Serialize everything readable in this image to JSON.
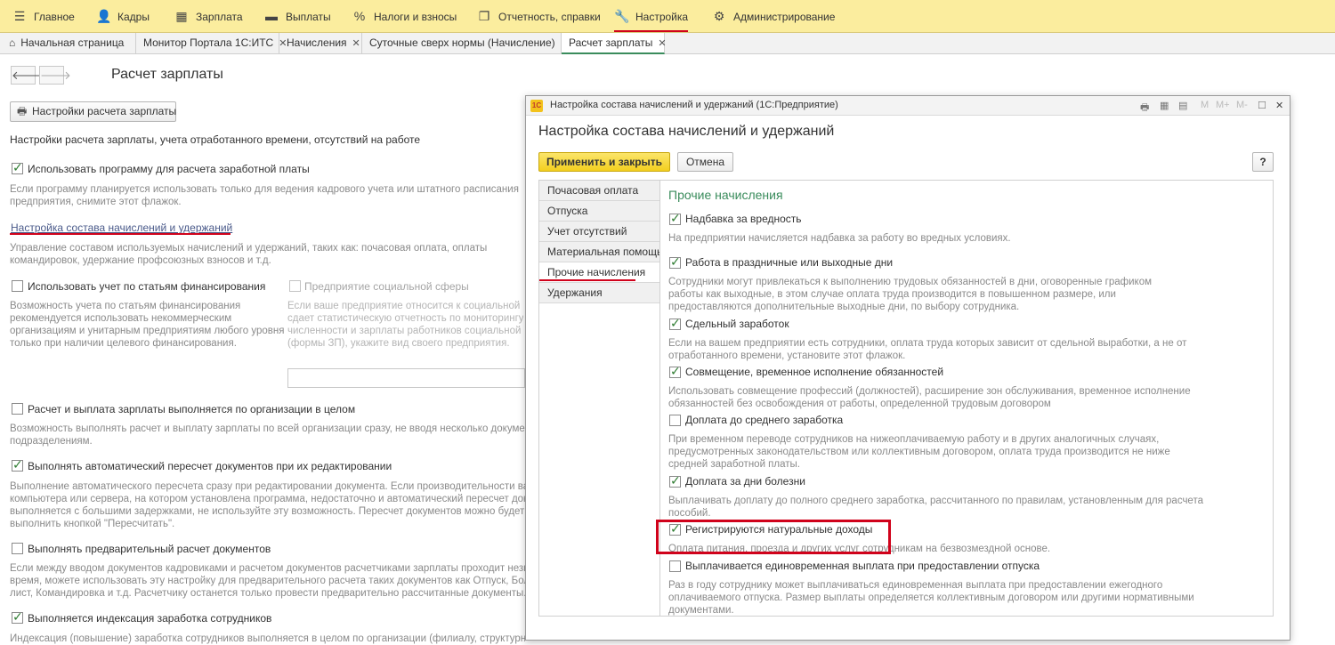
{
  "sections": [
    {
      "label": "Главное",
      "icon": "menu-icon"
    },
    {
      "label": "Кадры",
      "icon": "people-icon"
    },
    {
      "label": "Зарплата",
      "icon": "calculator-icon"
    },
    {
      "label": "Выплаты",
      "icon": "wallet-icon"
    },
    {
      "label": "Налоги и взносы",
      "icon": "percent-icon"
    },
    {
      "label": "Отчетность, справки",
      "icon": "report-icon"
    },
    {
      "label": "Настройка",
      "icon": "wrench-icon"
    },
    {
      "label": "Администрирование",
      "icon": "gear-icon"
    }
  ],
  "tabs": [
    {
      "label": "Начальная страница"
    },
    {
      "label": "Монитор Портала 1С:ИТС"
    },
    {
      "label": "Начисления"
    },
    {
      "label": "Суточные сверх нормы (Начисление)"
    },
    {
      "label": "Расчет зарплаты"
    }
  ],
  "page": {
    "title": "Расчет зарплаты",
    "settings_button": "Настройки расчета зарплаты",
    "intro": "Настройки расчета зарплаты, учета отработанного времени, отсутствий на работе",
    "opt_use_program": "Использовать программу для расчета заработной платы",
    "note_use_program": [
      "Если программу планируется использовать только для ведения кадрового учета или штатного расписания",
      "предприятия, снимите этот флажок."
    ],
    "link_setup": "Настройка состава начислений и удержаний",
    "note_setup": [
      "Управление составом используемых начислений и удержаний, таких как: почасовая оплата, оплаты",
      "командировок, удержание профсоюзных взносов и т.д."
    ],
    "opt_financing": "Использовать учет по статьям финансирования",
    "note_financing": [
      "Возможность учета по статьям финансирования",
      "рекомендуется использовать некоммерческим",
      "организациям и унитарным предприятиям любого уровня",
      "только при наличии целевого финансирования."
    ],
    "opt_social": "Предприятие социальной сферы",
    "note_social": [
      "Если ваше предприятие относится к социальной сф",
      "сдает статистическую отчетность по мониторингу",
      "численности и зарплаты работников социальной сф",
      "(формы ЗП), укажите вид своего предприятия."
    ],
    "opt_org": "Расчет и выплата зарплаты выполняется по организации в целом",
    "note_org": [
      "Возможность выполнять расчет и выплату зарплаты по всей организации сразу, не вводя несколько документ",
      "подразделениям."
    ],
    "opt_recalc": "Выполнять автоматический пересчет документов при их редактировании",
    "note_recalc": [
      "Выполнение автоматического пересчета сразу при редактировании документа. Если производительности ваш",
      "компьютера или сервера, на котором установлена программа, недостаточно и автоматический пересчет докум",
      "выполняется с большими задержками, не используйте эту возможность. Пересчет документов можно будет",
      "выполнить кнопкой \"Пересчитать\"."
    ],
    "opt_prelim": "Выполнять предварительный расчет документов",
    "note_prelim": [
      "Если между вводом документов кадровиками и расчетом документов расчетчиками зарплаты проходит незна",
      "время, можете использовать эту настройку для предварительного расчета таких документов как Отпуск, Боль",
      "лист, Командировка и т.д. Расчетчику останется только провести предварительно рассчитанные документы."
    ],
    "opt_index": "Выполняется индексация заработка сотрудников",
    "note_index": [
      "Индексация (повышение) заработка сотрудников выполняется в целом по организации (филиалу, структурному"
    ]
  },
  "dialog": {
    "window_title": "Настройка состава начислений и удержаний  (1С:Предприятие)",
    "logo_text": "1С",
    "toolbar": [
      "M",
      "M+",
      "M-"
    ],
    "heading": "Настройка состава начислений и удержаний",
    "apply_button": "Применить и закрыть",
    "cancel_button": "Отмена",
    "help_button": "?",
    "nav": [
      {
        "label": "Почасовая оплата"
      },
      {
        "label": "Отпуска"
      },
      {
        "label": "Учет отсутствий"
      },
      {
        "label": "Материальная помощь"
      },
      {
        "label": "Прочие начисления"
      },
      {
        "label": "Удержания"
      }
    ],
    "section_title": "Прочие начисления",
    "options": [
      {
        "label": "Надбавка за вредность",
        "checked": true,
        "note": [
          "На предприятии начисляется надбавка за работу во вредных условиях."
        ]
      },
      {
        "label": "Работа в праздничные или выходные дни",
        "checked": true,
        "note": [
          "Сотрудники могут привлекаться к выполнению трудовых обязанностей в дни, оговоренные графиком",
          "работы как выходные, в этом случае оплата труда производится в повышенном размере, или",
          "предоставляются дополнительные выходные дни, по выбору сотрудника."
        ]
      },
      {
        "label": "Сдельный заработок",
        "checked": true,
        "note": [
          "Если на вашем предприятии есть сотрудники, оплата труда которых зависит от сдельной выработки, а не от",
          "отработанного времени, установите этот флажок."
        ]
      },
      {
        "label": "Совмещение, временное исполнение обязанностей",
        "checked": true,
        "note": [
          "Использовать совмещение профессий (должностей), расширение зон обслуживания, временное исполнение",
          "обязанностей без освобождения от работы, определенной трудовым договором"
        ]
      },
      {
        "label": "Доплата до среднего заработка",
        "checked": false,
        "note": [
          "При временном переводе сотрудников на нижеоплачиваемую работу и в других аналогичных случаях,",
          "предусмотренных законодательством или коллективным договором, оплата труда производится не ниже",
          "средней заработной платы."
        ]
      },
      {
        "label": "Доплата за дни болезни",
        "checked": true,
        "note": [
          "Выплачивать доплату до полного среднего заработка, рассчитанного по правилам, установленным для расчета",
          "пособий."
        ]
      },
      {
        "label": "Регистрируются натуральные доходы",
        "checked": true,
        "note": [
          "Оплата питания, проезда и других услуг сотрудникам на безвозмездной основе."
        ]
      },
      {
        "label": "Выплачивается единовременная выплата при предоставлении отпуска",
        "checked": false,
        "note": [
          "Раз в году сотруднику может выплачиваться единовременная выплата при предоставлении ежегодного",
          "оплачиваемого отпуска. Размер выплаты определяется коллективным договором или другими нормативными",
          "документами."
        ]
      }
    ]
  },
  "colors": {
    "section_bar": "#fbed9e",
    "accent_green": "#3a8c5c",
    "highlight_red": "#d0021b",
    "apply_yellow": "#f3cf1f"
  }
}
